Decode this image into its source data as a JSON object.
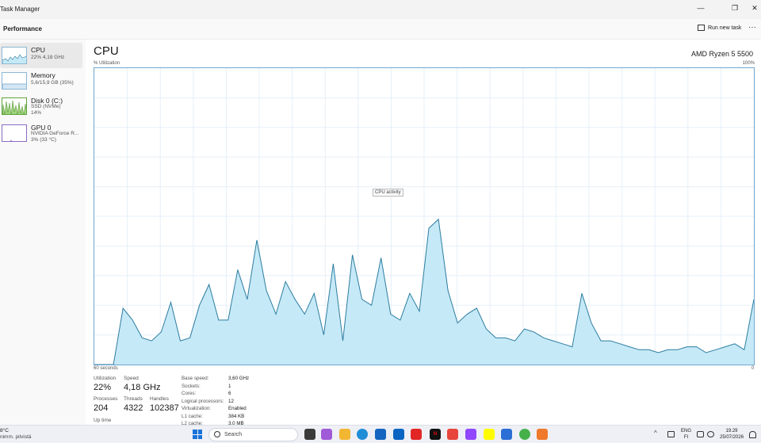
{
  "window": {
    "title": "Task Manager"
  },
  "header": {
    "section": "Performance",
    "run_new_task": "Run new task"
  },
  "sidebar": {
    "items": [
      {
        "name": "CPU",
        "line1": "22%  4,18 GHz",
        "line2": ""
      },
      {
        "name": "Memory",
        "line1": "5,6/15,9 GB (35%)",
        "line2": ""
      },
      {
        "name": "Disk 0 (C:)",
        "line1": "SSD (NVMe)",
        "line2": "14%"
      },
      {
        "name": "GPU 0",
        "line1": "NVIDIA GeForce R...",
        "line2": "3%  (33 °C)"
      }
    ]
  },
  "main": {
    "title": "CPU",
    "model": "AMD Ryzen 5 5500",
    "util_label": "% Utilization",
    "max_label": "100%",
    "tooltip": "CPU activity",
    "axis_left": "60 seconds",
    "axis_right": "0"
  },
  "chart_data": {
    "type": "area",
    "y_range": [
      0,
      100
    ],
    "x_range_seconds": [
      60,
      0
    ],
    "grid": true,
    "fill_color": "#c6e9f7",
    "line_color": "#2c7da0",
    "values": [
      0,
      0,
      0,
      19,
      15,
      9,
      8,
      11,
      21,
      8,
      9,
      20,
      27,
      15,
      15,
      32,
      22,
      42,
      25,
      17,
      28,
      22,
      17,
      24,
      10,
      34,
      8,
      37,
      22,
      20,
      36,
      17,
      15,
      24,
      18,
      46,
      49,
      25,
      14,
      17,
      19,
      12,
      9,
      9,
      8,
      12,
      11,
      9,
      8,
      7,
      6,
      24,
      14,
      8,
      8,
      7,
      6,
      5,
      5,
      4,
      5,
      5,
      6,
      6,
      4,
      5,
      6,
      7,
      5,
      22
    ]
  },
  "stats": {
    "utilization": {
      "label": "Utilization",
      "value": "22%"
    },
    "speed": {
      "label": "Speed",
      "value": "4,18 GHz"
    },
    "processes": {
      "label": "Processes",
      "value": "204"
    },
    "threads": {
      "label": "Threads",
      "value": "4322"
    },
    "handles": {
      "label": "Handles",
      "value": "102387"
    },
    "uptime": {
      "label": "Up time"
    }
  },
  "specs": [
    {
      "k": "Base speed:",
      "v": "3,60 GHz"
    },
    {
      "k": "Sockets:",
      "v": "1"
    },
    {
      "k": "Cores:",
      "v": "6"
    },
    {
      "k": "Logical processors:",
      "v": "12"
    },
    {
      "k": "Virtualization:",
      "v": "Enabled"
    },
    {
      "k": "L1 cache:",
      "v": "384 KB"
    },
    {
      "k": "L2 cache:",
      "v": "3,0 MB"
    }
  ],
  "taskbar": {
    "weather_temp": "8°C",
    "weather_desc": "nimm. pilvistä",
    "search": "Search",
    "lang1": "ENG",
    "lang2": "FI",
    "time": "19.29",
    "date": "25/07/2026"
  }
}
